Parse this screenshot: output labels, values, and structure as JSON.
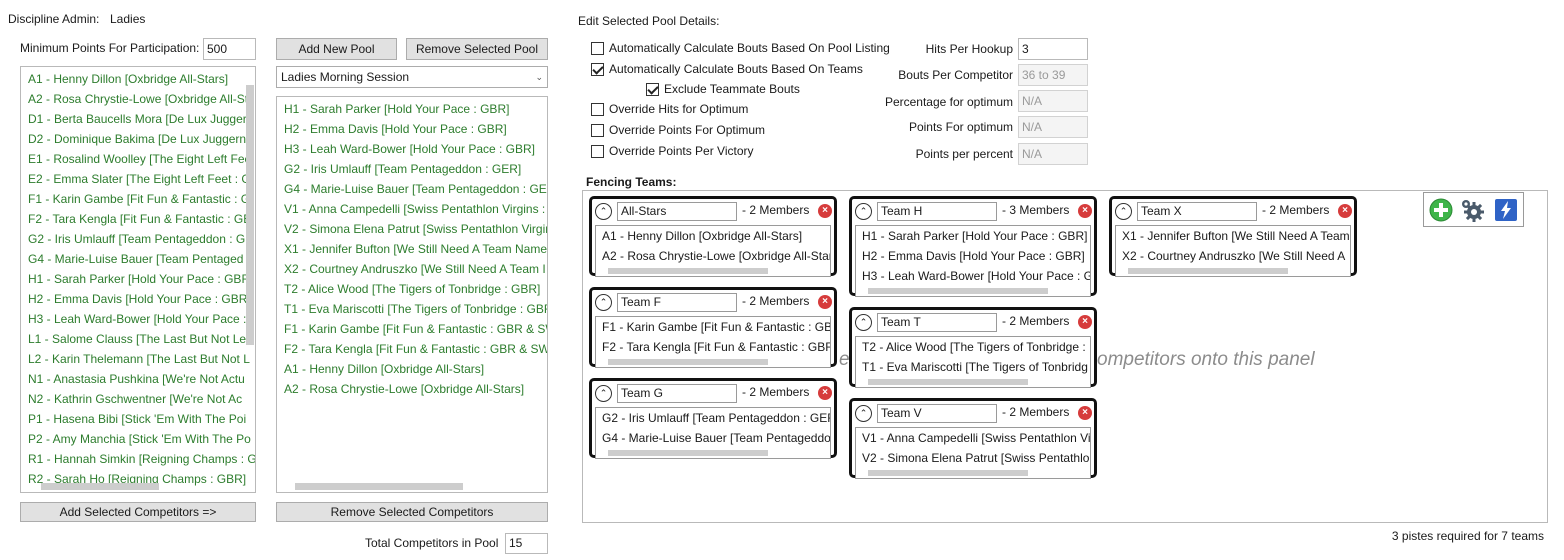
{
  "admin": {
    "label": "Discipline Admin:",
    "value": "Ladies"
  },
  "min_points": {
    "label": "Minimum Points For Participation:",
    "value": "500"
  },
  "competitors": [
    "A1 - Henny Dillon  [Oxbridge All-Stars]",
    "A2 - Rosa Chrystie-Lowe  [Oxbridge All-St",
    "D1 - Berta Baucells Mora  [De Lux Jugger",
    "D2 - Dominique Bakima  [De Lux Juggern",
    "E1 - Rosalind Woolley  [The Eight Left Fee",
    "E2 - Emma Slater  [The Eight Left Feet : G",
    "F1 - Karin Gambe  [Fit Fun & Fantastic : G",
    "F2 - Tara Kengla  [Fit Fun & Fantastic : GB",
    "G2 - Iris Umlauff  [Team Pentageddon : G",
    "G4 - Marie-Luise Bauer  [Team Pentaged",
    "H1 - Sarah Parker  [Hold Your Pace : GBR]",
    "H2 - Emma Davis  [Hold Your Pace : GBR]",
    "H3 - Leah Ward-Bower  [Hold Your Pace :",
    "L1 - Salome Clauss  [The Last But Not Lea",
    "L2 - Karin Thelemann  [The Last But Not L",
    "N1 - Anastasia Pushkina  [We're Not Actu",
    "N2 - Kathrin Gschwentner  [We're Not Ac",
    "P1 - Hasena Bibi  [Stick 'Em With The Poi",
    "P2 - Amy Manchia  [Stick 'Em With The Po",
    "R1 - Hannah Simkin  [Reigning Champs : G",
    "R2 - Sarah Ho  [Reigning Champs : GBR]"
  ],
  "add_competitors_button": "Add Selected Competitors =>",
  "add_pool_button": "Add New Pool",
  "remove_pool_button": "Remove Selected Pool",
  "pool_select": "Ladies Morning Session",
  "pool_members": [
    "H1 - Sarah Parker  [Hold Your Pace : GBR]",
    "H2 - Emma Davis  [Hold Your Pace : GBR]",
    "H3 - Leah Ward-Bower  [Hold Your Pace : GBR]",
    "G2 - Iris Umlauff  [Team Pentageddon : GER]",
    "G4 - Marie-Luise Bauer  [Team Pentageddon : GER",
    "V1 - Anna Campedelli  [Swiss Pentathlon Virgins :",
    "V2 - Simona Elena Patrut  [Swiss Pentathlon Virgir",
    "X1 - Jennifer Bufton  [We Still Need A Team Name",
    "X2 - Courtney Andruszko  [We Still Need A Team I",
    "T2 - Alice Wood  [The Tigers of Tonbridge : GBR]",
    "T1 - Eva Mariscotti  [The Tigers of Tonbridge : GBF",
    "F1 - Karin Gambe  [Fit Fun & Fantastic : GBR & SW",
    "F2 - Tara Kengla  [Fit Fun & Fantastic : GBR & SWZ",
    "A1 - Henny Dillon  [Oxbridge All-Stars]",
    "A2 - Rosa Chrystie-Lowe  [Oxbridge All-Stars]"
  ],
  "remove_competitors_button": "Remove Selected Competitors",
  "total": {
    "label": "Total Competitors in Pool",
    "value": "15"
  },
  "pool_details": {
    "title": "Edit Selected Pool Details:",
    "opt_auto_listing": {
      "label": "Automatically Calculate Bouts Based On Pool Listing",
      "checked": false
    },
    "opt_auto_teams": {
      "label": "Automatically Calculate Bouts Based On Teams",
      "checked": true
    },
    "opt_exclude_teammates": {
      "label": "Exclude Teammate Bouts",
      "checked": true
    },
    "opt_override_hits": {
      "label": "Override Hits for Optimum",
      "checked": false
    },
    "opt_override_points": {
      "label": "Override Points For Optimum",
      "checked": false
    },
    "opt_override_ppv": {
      "label": "Override Points Per Victory",
      "checked": false
    },
    "hits_per_hookup": {
      "label": "Hits Per Hookup",
      "value": "3"
    },
    "bouts_per_competitor": {
      "label": "Bouts Per Competitor",
      "value": "36 to 39"
    },
    "pct_optimum": {
      "label": "Percentage for optimum",
      "value": "N/A"
    },
    "points_optimum": {
      "label": "Points For optimum",
      "value": "N/A"
    },
    "points_per_percent": {
      "label": "Points per percent",
      "value": "N/A"
    }
  },
  "fencing_teams": {
    "label": "Fencing Teams:",
    "hint_left": "e",
    "hint_right": "ompetitors onto this panel",
    "tools": [
      "add-team-icon",
      "settings-gear-icon",
      "auto-generate-icon"
    ],
    "teams": [
      {
        "name": "All-Stars",
        "count": "- 2 Members",
        "members": [
          "A1 - Henny Dillon  [Oxbridge All-Stars]",
          "A2 - Rosa Chrystie-Lowe  [Oxbridge All-Star"
        ]
      },
      {
        "name": "Team F",
        "count": "- 2 Members",
        "members": [
          "F1 - Karin Gambe  [Fit Fun & Fantastic : GBR",
          "F2 - Tara Kengla  [Fit Fun & Fantastic : GBR"
        ]
      },
      {
        "name": "Team G",
        "count": "- 2 Members",
        "members": [
          "G2 - Iris Umlauff  [Team Pentageddon : GEF",
          "G4 - Marie-Luise Bauer  [Team Pentageddo"
        ]
      },
      {
        "name": "Team H",
        "count": "- 3 Members",
        "members": [
          "H1 - Sarah Parker  [Hold Your Pace : GBR]",
          "H2 - Emma Davis  [Hold Your Pace : GBR]",
          "H3 - Leah Ward-Bower  [Hold Your Pace : G"
        ]
      },
      {
        "name": "Team T",
        "count": "- 2 Members",
        "members": [
          "T2 - Alice Wood  [The Tigers of Tonbridge :",
          "T1 - Eva Mariscotti  [The Tigers of Tonbridg"
        ]
      },
      {
        "name": "Team V",
        "count": "- 2 Members",
        "members": [
          "V1 - Anna Campedelli  [Swiss Pentathlon Vi",
          "V2 - Simona Elena Patrut  [Swiss Pentathlor"
        ]
      },
      {
        "name": "Team X",
        "count": "- 2 Members",
        "members": [
          "X1 - Jennifer Bufton  [We Still Need A Team",
          "X2 - Courtney Andruszko  [We Still Need A"
        ]
      }
    ]
  },
  "status": "3 pistes required for 7 teams"
}
